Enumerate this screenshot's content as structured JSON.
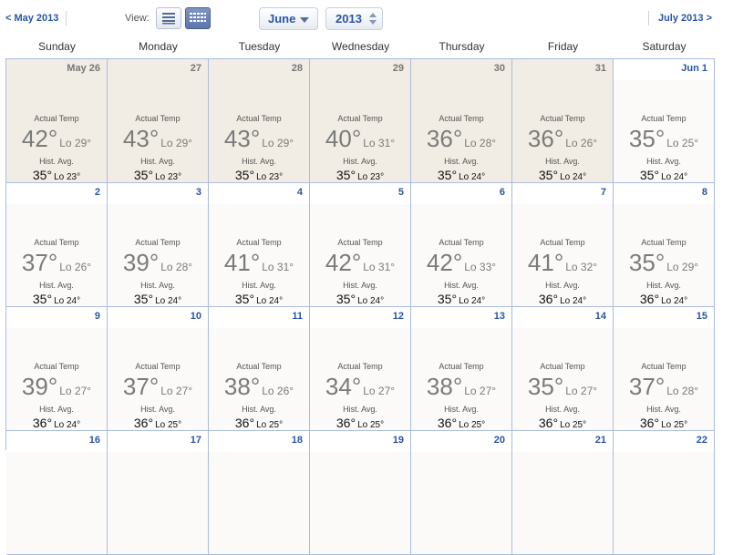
{
  "nav": {
    "prev_label": "< May 2013",
    "next_label": "July 2013 >",
    "view_label": "View:",
    "month_value": "June",
    "year_value": "2013",
    "list_view_icon": "list-view-icon",
    "grid_view_icon": "calendar-grid-icon"
  },
  "labels": {
    "actual": "Actual Temp",
    "hist": "Hist. Avg."
  },
  "weekdays": [
    "Sunday",
    "Monday",
    "Tuesday",
    "Wednesday",
    "Thursday",
    "Friday",
    "Saturday"
  ],
  "weeks": [
    [
      {
        "day": "May 26",
        "hi": "42°",
        "lo": "Lo 29°",
        "avg_hi": "35°",
        "avg_lo": "Lo 23°"
      },
      {
        "day": "27",
        "hi": "43°",
        "lo": "Lo 29°",
        "avg_hi": "35°",
        "avg_lo": "Lo 23°"
      },
      {
        "day": "28",
        "hi": "43°",
        "lo": "Lo 29°",
        "avg_hi": "35°",
        "avg_lo": "Lo 23°"
      },
      {
        "day": "29",
        "hi": "40°",
        "lo": "Lo 31°",
        "avg_hi": "35°",
        "avg_lo": "Lo 23°"
      },
      {
        "day": "30",
        "hi": "36°",
        "lo": "Lo 28°",
        "avg_hi": "35°",
        "avg_lo": "Lo 24°"
      },
      {
        "day": "31",
        "hi": "36°",
        "lo": "Lo 26°",
        "avg_hi": "35°",
        "avg_lo": "Lo 24°"
      },
      {
        "day": "Jun 1",
        "hi": "35°",
        "lo": "Lo 25°",
        "avg_hi": "35°",
        "avg_lo": "Lo 24°"
      }
    ],
    [
      {
        "day": "2",
        "hi": "37°",
        "lo": "Lo 26°",
        "avg_hi": "35°",
        "avg_lo": "Lo 24°"
      },
      {
        "day": "3",
        "hi": "39°",
        "lo": "Lo 28°",
        "avg_hi": "35°",
        "avg_lo": "Lo 24°"
      },
      {
        "day": "4",
        "hi": "41°",
        "lo": "Lo 31°",
        "avg_hi": "35°",
        "avg_lo": "Lo 24°"
      },
      {
        "day": "5",
        "hi": "42°",
        "lo": "Lo 31°",
        "avg_hi": "35°",
        "avg_lo": "Lo 24°"
      },
      {
        "day": "6",
        "hi": "42°",
        "lo": "Lo 33°",
        "avg_hi": "35°",
        "avg_lo": "Lo 24°"
      },
      {
        "day": "7",
        "hi": "41°",
        "lo": "Lo 32°",
        "avg_hi": "36°",
        "avg_lo": "Lo 24°"
      },
      {
        "day": "8",
        "hi": "35°",
        "lo": "Lo 29°",
        "avg_hi": "36°",
        "avg_lo": "Lo 24°"
      }
    ],
    [
      {
        "day": "9",
        "hi": "39°",
        "lo": "Lo 27°",
        "avg_hi": "36°",
        "avg_lo": "Lo 24°"
      },
      {
        "day": "10",
        "hi": "37°",
        "lo": "Lo 27°",
        "avg_hi": "36°",
        "avg_lo": "Lo 25°"
      },
      {
        "day": "11",
        "hi": "38°",
        "lo": "Lo 26°",
        "avg_hi": "36°",
        "avg_lo": "Lo 25°"
      },
      {
        "day": "12",
        "hi": "34°",
        "lo": "Lo 27°",
        "avg_hi": "36°",
        "avg_lo": "Lo 25°"
      },
      {
        "day": "13",
        "hi": "38°",
        "lo": "Lo 27°",
        "avg_hi": "36°",
        "avg_lo": "Lo 25°"
      },
      {
        "day": "14",
        "hi": "35°",
        "lo": "Lo 27°",
        "avg_hi": "36°",
        "avg_lo": "Lo 25°"
      },
      {
        "day": "15",
        "hi": "37°",
        "lo": "Lo 28°",
        "avg_hi": "36°",
        "avg_lo": "Lo 25°"
      }
    ]
  ],
  "next_week_partial": [
    "16",
    "17",
    "18",
    "19",
    "20",
    "21",
    "22"
  ],
  "past_cells": [
    "May 26",
    "27",
    "28",
    "29",
    "30",
    "31"
  ],
  "colors": {
    "link": "#2a56a6",
    "past_bg": "#f1ede4",
    "grid_line": "#a9bde0",
    "view_active": "#5c76ad"
  }
}
